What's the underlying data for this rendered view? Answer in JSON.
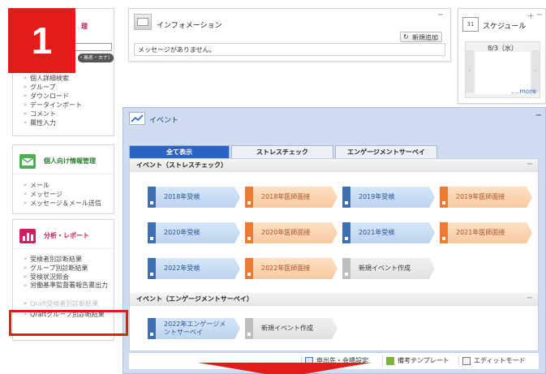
{
  "step_badge": "1",
  "colors": {
    "accent_blue": "#2d62c5",
    "accent_orange": "#f07b2f",
    "highlight_red": "#e21b1b"
  },
  "sidebar": {
    "section1": {
      "title_fragment": "理",
      "search_placeholder": "",
      "search_button": "・高名・カナ）",
      "items": [
        "個人詳細検索",
        "グループ",
        "ダウンロード",
        "データインポート",
        "コメント",
        "属性入力"
      ]
    },
    "section2": {
      "title": "個人向け情報管理",
      "items": [
        "メール",
        "メッセージ",
        "メッセージ＆メール送信"
      ]
    },
    "section3": {
      "title": "分析・レポート",
      "items": [
        "受検者別診断結果",
        "グループ別診断結果",
        "受検状況照会",
        "労働基準監督署報告書出力",
        "Qraft受検者別診断結果",
        "Qraftグループ別診断結果"
      ]
    }
  },
  "info": {
    "title": "インフォメーション",
    "add_button": "新規追加",
    "message": "メッセージがありません。"
  },
  "schedule": {
    "title": "スケジュール",
    "date": "8/3（水）",
    "more": "....more",
    "icon_number": "31"
  },
  "event_panel": {
    "title": "イベント",
    "tabs": [
      "全て表示",
      "ストレスチェック",
      "エンゲージメントサーベイ"
    ],
    "stress_section": "イベント（ストレスチェック）",
    "engagement_section": "イベント（エンゲージメントサーベイ）",
    "stress_events": [
      {
        "label": "2018年受検",
        "kind": "exam"
      },
      {
        "label": "2018年医師面接",
        "kind": "interview"
      },
      {
        "label": "2019年受検",
        "kind": "exam"
      },
      {
        "label": "2019年医師面接",
        "kind": "interview"
      },
      {
        "label": "2020年受検",
        "kind": "exam"
      },
      {
        "label": "2020年医師面接",
        "kind": "interview"
      },
      {
        "label": "2021年受検",
        "kind": "exam"
      },
      {
        "label": "2021年医師面接",
        "kind": "interview"
      },
      {
        "label": "2022年受検",
        "kind": "exam"
      },
      {
        "label": "2022年医師面接",
        "kind": "interview"
      },
      {
        "label": "新規イベント作成",
        "kind": "new"
      }
    ],
    "engagement_events": [
      {
        "label": "2022年エンゲージメ\nントサーベイ",
        "kind": "exam"
      },
      {
        "label": "新規イベント作成",
        "kind": "new"
      }
    ],
    "bottom_buttons": [
      "申出先・会場設定",
      "備考テンプレート",
      "エディットモード"
    ]
  }
}
